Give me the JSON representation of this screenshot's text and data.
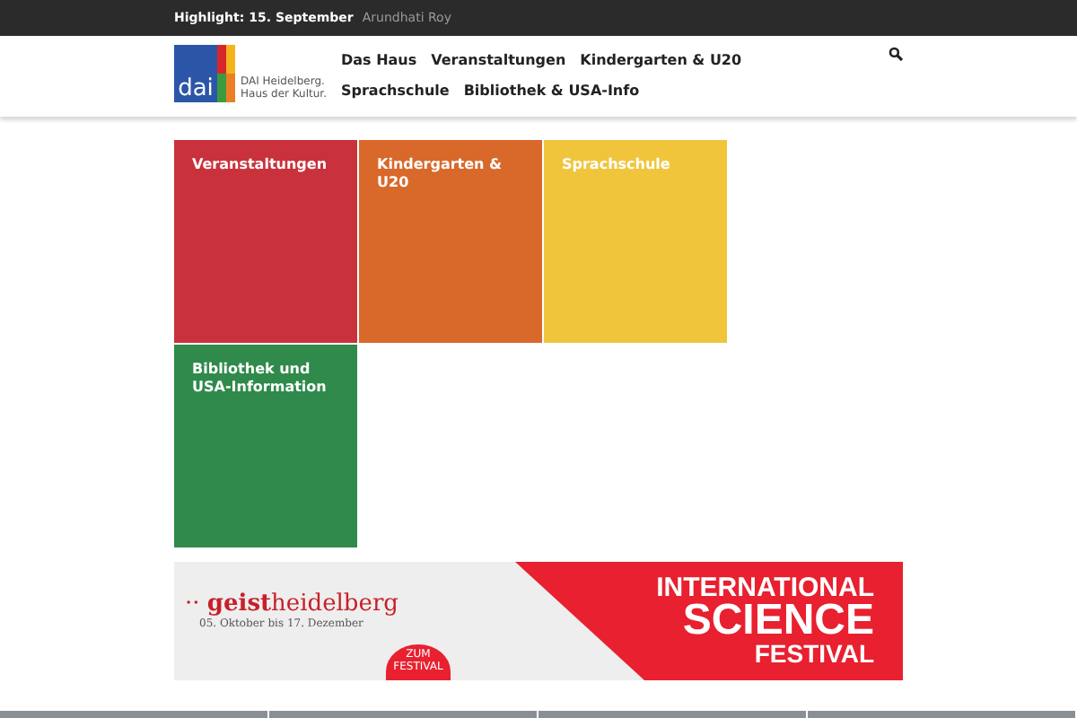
{
  "top_bar": {
    "label": "Highlight: 15. September",
    "link": "Arundhati Roy"
  },
  "header": {
    "logo": {
      "mark": "dai",
      "text_line1": "DAI Heidelberg.",
      "text_line2": "Haus der Kultur."
    },
    "nav": [
      "Das Haus",
      "Veranstaltungen",
      "Kindergarten & U20",
      "Sprachschule",
      "Bibliothek & USA-Info"
    ]
  },
  "tiles": [
    {
      "title": "Veranstaltungen",
      "color": "#c9323c"
    },
    {
      "title": "Kindergarten & U20",
      "color": "#d8692b"
    },
    {
      "title": "Sprachschule",
      "color": "#f0c53c"
    },
    {
      "title": "Bibliothek und USA-Information",
      "color": "#2f8a4b"
    }
  ],
  "banner": {
    "brand_mark": "··",
    "brand_prefix": "geist",
    "brand_suffix": "heidelberg",
    "dates": "05. Oktober bis 17. Dezember",
    "cta_line1": "ZUM",
    "cta_line2": "FESTIVAL",
    "headline1": "INTERNATIONAL",
    "headline2": "SCIENCE",
    "headline3": "FESTIVAL"
  }
}
